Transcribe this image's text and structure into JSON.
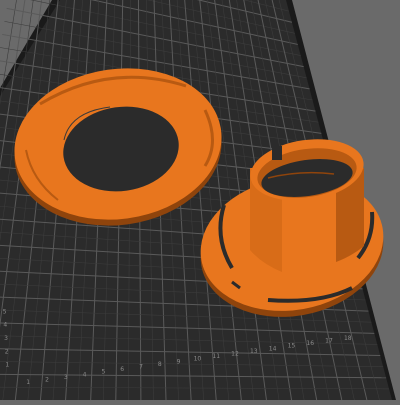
{
  "viewport": {
    "name": "3D slicer plate preview",
    "colors": {
      "background": "#6a6a6a",
      "plate": "#2b2b2b",
      "plate_edge": "#1a1a1a",
      "grid_minor": "#3c3c3c",
      "grid_major": "#5a5a5a",
      "part_fill": "#e8761e",
      "part_dark": "#b85a12",
      "part_shadow": "#8f440c",
      "label": "#8a8a8a"
    }
  },
  "plate": {
    "ruler_x_labels": [
      "1",
      "2",
      "3",
      "4",
      "5",
      "6",
      "7",
      "8",
      "9",
      "10",
      "11",
      "12",
      "13",
      "14",
      "15",
      "16",
      "17",
      "18"
    ],
    "ruler_y_labels": [
      "1",
      "2",
      "3",
      "4",
      "5"
    ]
  },
  "models": [
    {
      "name": "flat-ring",
      "color": "#e8761e"
    },
    {
      "name": "spool-hub",
      "color": "#e8761e"
    }
  ]
}
